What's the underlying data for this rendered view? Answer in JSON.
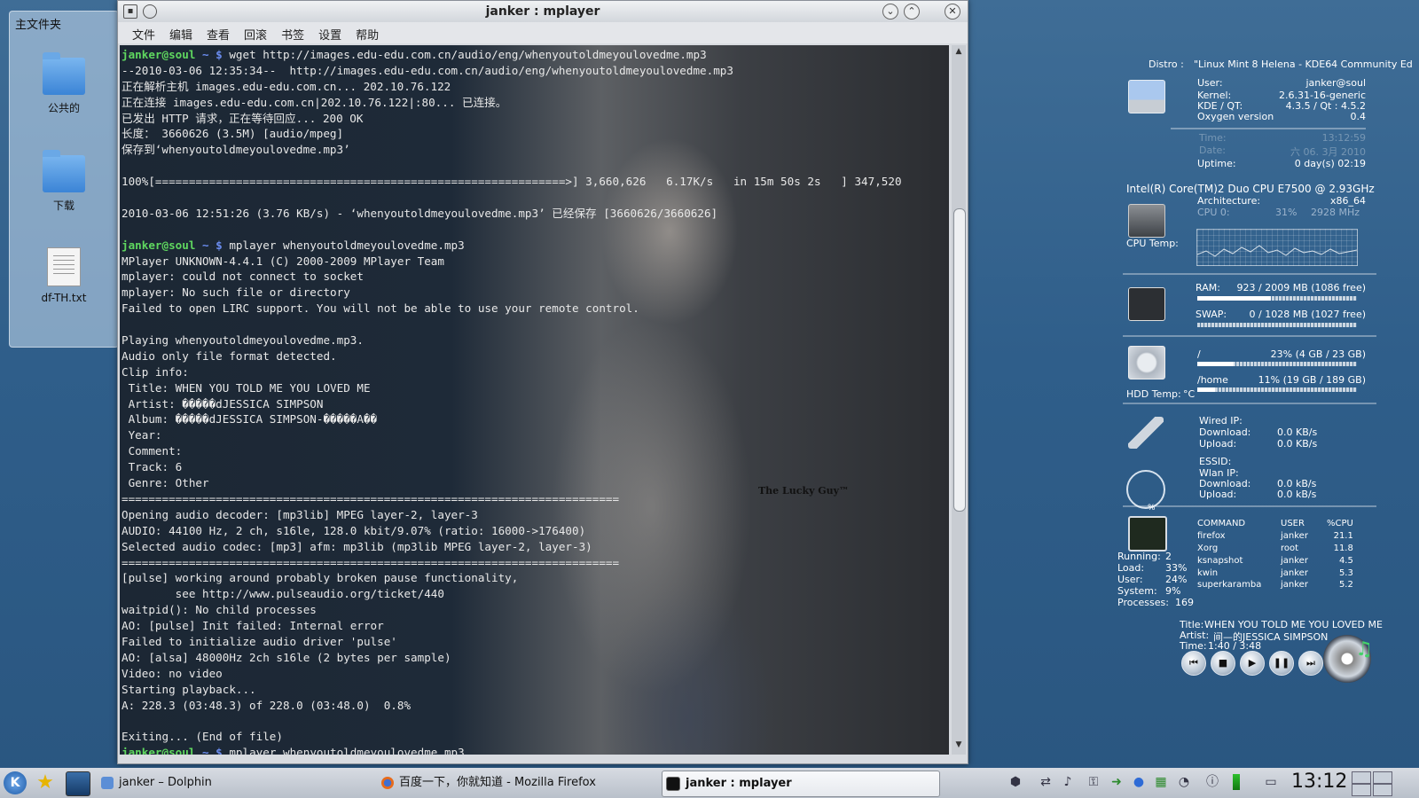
{
  "desktop": {
    "folder_panel_title": "主文件夹",
    "icons": [
      {
        "label": "公共的",
        "icon": "folder-icon"
      },
      {
        "label": "下载",
        "icon": "folder-icon"
      },
      {
        "label": "df-TH.txt",
        "icon": "text-file-icon"
      }
    ]
  },
  "window": {
    "title": "janker : mplayer",
    "menu": [
      "文件",
      "编辑",
      "查看",
      "回滚",
      "书签",
      "设置",
      "帮助"
    ]
  },
  "terminal": {
    "watermark": "The Lucky Guy™",
    "lines": [
      {
        "user": "janker@soul",
        "dir": " ~ $ ",
        "text": "wget http://images.edu-edu.com.cn/audio/eng/whenyoutoldmeyoulovedme.mp3"
      },
      {
        "text": "--2010-03-06 12:35:34--  http://images.edu-edu.com.cn/audio/eng/whenyoutoldmeyoulovedme.mp3"
      },
      {
        "text": "正在解析主机 images.edu-edu.com.cn... 202.10.76.122"
      },
      {
        "text": "正在连接 images.edu-edu.com.cn|202.10.76.122|:80... 已连接。"
      },
      {
        "text": "已发出 HTTP 请求，正在等待回应... 200 OK"
      },
      {
        "text": "长度： 3660626 (3.5M) [audio/mpeg]"
      },
      {
        "text": "保存到‘whenyoutoldmeyoulovedme.mp3’"
      },
      {
        "text": ""
      },
      {
        "text": "100%[=============================================================>] 3,660,626   6.17K/s   in 15m 50s 2s   ] 347,520"
      },
      {
        "text": ""
      },
      {
        "text": "2010-03-06 12:51:26 (3.76 KB/s) - ‘whenyoutoldmeyoulovedme.mp3’ 已经保存 [3660626/3660626]"
      },
      {
        "text": ""
      },
      {
        "user": "janker@soul",
        "dir": " ~ $ ",
        "text": "mplayer whenyoutoldmeyoulovedme.mp3"
      },
      {
        "text": "MPlayer UNKNOWN-4.4.1 (C) 2000-2009 MPlayer Team"
      },
      {
        "text": "mplayer: could not connect to socket"
      },
      {
        "text": "mplayer: No such file or directory"
      },
      {
        "text": "Failed to open LIRC support. You will not be able to use your remote control."
      },
      {
        "text": ""
      },
      {
        "text": "Playing whenyoutoldmeyoulovedme.mp3."
      },
      {
        "text": "Audio only file format detected."
      },
      {
        "text": "Clip info:"
      },
      {
        "text": " Title: WHEN YOU TOLD ME YOU LOVED ME"
      },
      {
        "text": " Artist: �����dJESSICA SIMPSON"
      },
      {
        "text": " Album: �����dJESSICA SIMPSON-�����A��"
      },
      {
        "text": " Year:"
      },
      {
        "text": " Comment:"
      },
      {
        "text": " Track: 6"
      },
      {
        "text": " Genre: Other"
      },
      {
        "text": "=========================================================================="
      },
      {
        "text": "Opening audio decoder: [mp3lib] MPEG layer-2, layer-3"
      },
      {
        "text": "AUDIO: 44100 Hz, 2 ch, s16le, 128.0 kbit/9.07% (ratio: 16000->176400)"
      },
      {
        "text": "Selected audio codec: [mp3] afm: mp3lib (mp3lib MPEG layer-2, layer-3)"
      },
      {
        "text": "=========================================================================="
      },
      {
        "text": "[pulse] working around probably broken pause functionality,"
      },
      {
        "text": "        see http://www.pulseaudio.org/ticket/440"
      },
      {
        "text": "waitpid(): No child processes"
      },
      {
        "text": "AO: [pulse] Init failed: Internal error"
      },
      {
        "text": "Failed to initialize audio driver 'pulse'"
      },
      {
        "text": "AO: [alsa] 48000Hz 2ch s16le (2 bytes per sample)"
      },
      {
        "text": "Video: no video"
      },
      {
        "text": "Starting playback..."
      },
      {
        "text": "A: 228.3 (03:48.3) of 228.0 (03:48.0)  0.8%"
      },
      {
        "text": ""
      },
      {
        "text": "Exiting... (End of file)"
      },
      {
        "user": "janker@soul",
        "dir": " ~ $ ",
        "text": "mplayer whenyoutoldmeyoulovedme.mp3"
      }
    ]
  },
  "sysmon": {
    "distro_label": "Distro :",
    "distro_value": "\"Linux Mint 8 Helena - KDE64 Community Ed",
    "user_label": "User:",
    "user_value": "janker@soul",
    "kernel_label": "Kernel:",
    "kernel_value": "2.6.31-16-generic",
    "kde_label": "KDE / QT:",
    "kde_value": "4.3.5 / Qt : 4.5.2",
    "oxygen_label": "Oxygen version",
    "oxygen_value": "0.4",
    "time_label": "Time:",
    "time_value": "13:12:59",
    "date_label": "Date:",
    "date_value": "六 06. 3月 2010",
    "uptime_label": "Uptime:",
    "uptime_value": "0 day(s)  02:19",
    "cpu_model": "Intel(R) Core(TM)2 Duo CPU     E7500  @ 2.93GHz",
    "arch_label": "Architecture:",
    "arch_value": "x86_64",
    "cpu0_label": "CPU 0:",
    "cpu0_pct": "31%",
    "cpu0_mhz": "2928 MHz",
    "cpu_temp_label": "CPU Temp:",
    "ram_label": "RAM:",
    "ram_value": "923 / 2009 MB (1086 free)",
    "ram_fraction": 0.46,
    "swap_label": "SWAP:",
    "swap_value": "0 / 1028 MB (1027 free)",
    "swap_fraction": 0.0,
    "root_label": "/",
    "root_value": "23% (4 GB / 23 GB)",
    "root_fraction": 0.23,
    "home_label": "/home",
    "home_value": "11% (19 GB / 189 GB)",
    "home_fraction": 0.11,
    "hdd_temp_label": "HDD Temp:",
    "hdd_temp_value": "°C",
    "wired_ip_label": "Wired IP:",
    "wired_down_label": "Download:",
    "wired_down_value": "0.0 KB/s",
    "wired_up_label": "Upload:",
    "wired_up_value": "0.0 KB/s",
    "essid_label": "ESSID:",
    "wlan_ip_label": "Wlan IP:",
    "wlan_down_label": "Download:",
    "wlan_down_value": "0.0 kB/s",
    "wlan_up_label": "Upload:",
    "wlan_up_value": "0.0 kB/s",
    "wlan_pct": "%",
    "running_label": "Running:",
    "running_value": "2",
    "load_label": "Load:",
    "load_value": "33%",
    "cpu_user_label": "User:",
    "cpu_user_value": "24%",
    "system_label": "System:",
    "system_value": "9%",
    "processes_label": "Processes:",
    "processes_value": "169",
    "proc_headers": [
      "COMMAND",
      "USER",
      "%CPU"
    ],
    "procs": [
      [
        "firefox",
        "janker",
        "21.1"
      ],
      [
        "Xorg",
        "root",
        "11.8"
      ],
      [
        "ksnapshot",
        "janker",
        "4.5"
      ],
      [
        "kwin",
        "janker",
        "5.3"
      ],
      [
        "superkaramba",
        "janker",
        "5.2"
      ]
    ],
    "np_title_label": "Title:",
    "np_title_value": "WHEN YOU TOLD ME YOU LOVED ME",
    "np_artist_label": "Artist:",
    "np_artist_value": "间—的JESSICA SIMPSON",
    "np_time_label": "Time:",
    "np_time_value": "1:40 / 3:48"
  },
  "taskbar": {
    "tasks": [
      {
        "label": "janker – Dolphin"
      },
      {
        "label": "百度一下，你就知道 - Mozilla Firefox"
      },
      {
        "label": "janker : mplayer"
      }
    ],
    "clock": "13:12"
  }
}
